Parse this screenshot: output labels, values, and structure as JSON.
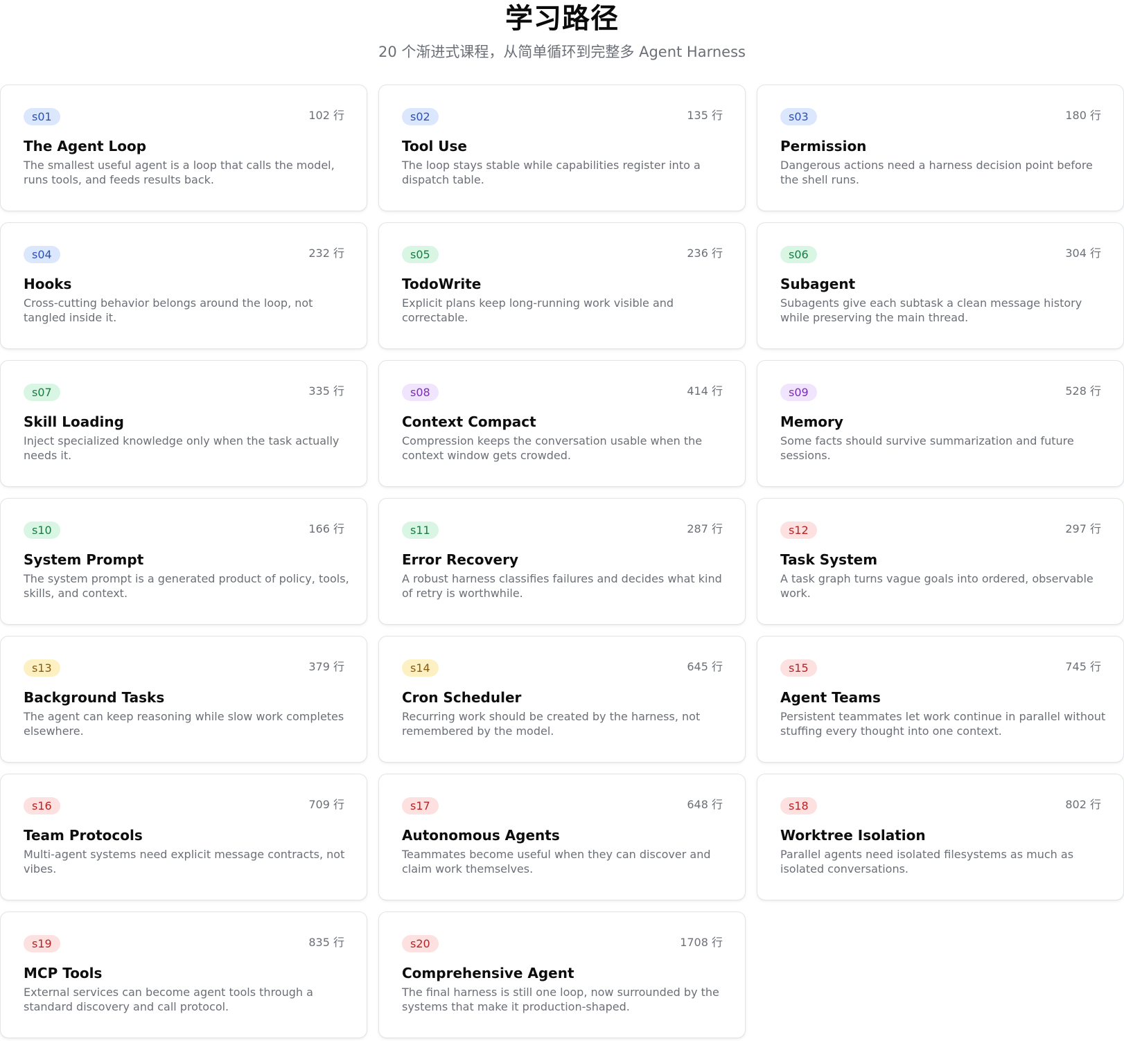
{
  "header": {
    "title": "学习路径",
    "subtitle": "20 个渐进式课程，从简单循环到完整多 Agent Harness"
  },
  "colors": {
    "blue": "#dbe7fd",
    "green": "#d8f6e3",
    "purple": "#f1e4fd",
    "red": "#fde0e0",
    "yellow": "#fdf1c4"
  },
  "lessons": [
    {
      "id": "s01",
      "lines": "102 行",
      "color": "blue",
      "title": "The Agent Loop",
      "desc": "The smallest useful agent is a loop that calls the model, runs tools, and feeds results back."
    },
    {
      "id": "s02",
      "lines": "135 行",
      "color": "blue",
      "title": "Tool Use",
      "desc": "The loop stays stable while capabilities register into a dispatch table."
    },
    {
      "id": "s03",
      "lines": "180 行",
      "color": "blue",
      "title": "Permission",
      "desc": "Dangerous actions need a harness decision point before the shell runs."
    },
    {
      "id": "s04",
      "lines": "232 行",
      "color": "blue",
      "title": "Hooks",
      "desc": "Cross-cutting behavior belongs around the loop, not tangled inside it."
    },
    {
      "id": "s05",
      "lines": "236 行",
      "color": "green",
      "title": "TodoWrite",
      "desc": "Explicit plans keep long-running work visible and correctable."
    },
    {
      "id": "s06",
      "lines": "304 行",
      "color": "green",
      "title": "Subagent",
      "desc": "Subagents give each subtask a clean message history while preserving the main thread."
    },
    {
      "id": "s07",
      "lines": "335 行",
      "color": "green",
      "title": "Skill Loading",
      "desc": "Inject specialized knowledge only when the task actually needs it."
    },
    {
      "id": "s08",
      "lines": "414 行",
      "color": "purple",
      "title": "Context Compact",
      "desc": "Compression keeps the conversation usable when the context window gets crowded."
    },
    {
      "id": "s09",
      "lines": "528 行",
      "color": "purple",
      "title": "Memory",
      "desc": "Some facts should survive summarization and future sessions."
    },
    {
      "id": "s10",
      "lines": "166 行",
      "color": "green",
      "title": "System Prompt",
      "desc": "The system prompt is a generated product of policy, tools, skills, and context."
    },
    {
      "id": "s11",
      "lines": "287 行",
      "color": "green",
      "title": "Error Recovery",
      "desc": "A robust harness classifies failures and decides what kind of retry is worthwhile."
    },
    {
      "id": "s12",
      "lines": "297 行",
      "color": "red",
      "title": "Task System",
      "desc": "A task graph turns vague goals into ordered, observable work."
    },
    {
      "id": "s13",
      "lines": "379 行",
      "color": "yellow",
      "title": "Background Tasks",
      "desc": "The agent can keep reasoning while slow work completes elsewhere."
    },
    {
      "id": "s14",
      "lines": "645 行",
      "color": "yellow",
      "title": "Cron Scheduler",
      "desc": "Recurring work should be created by the harness, not remembered by the model."
    },
    {
      "id": "s15",
      "lines": "745 行",
      "color": "red",
      "title": "Agent Teams",
      "desc": "Persistent teammates let work continue in parallel without stuffing every thought into one context."
    },
    {
      "id": "s16",
      "lines": "709 行",
      "color": "red",
      "title": "Team Protocols",
      "desc": "Multi-agent systems need explicit message contracts, not vibes."
    },
    {
      "id": "s17",
      "lines": "648 行",
      "color": "red",
      "title": "Autonomous Agents",
      "desc": "Teammates become useful when they can discover and claim work themselves."
    },
    {
      "id": "s18",
      "lines": "802 行",
      "color": "red",
      "title": "Worktree Isolation",
      "desc": "Parallel agents need isolated filesystems as much as isolated conversations."
    },
    {
      "id": "s19",
      "lines": "835 行",
      "color": "red",
      "title": "MCP Tools",
      "desc": "External services can become agent tools through a standard discovery and call protocol."
    },
    {
      "id": "s20",
      "lines": "1708 行",
      "color": "red",
      "title": "Comprehensive Agent",
      "desc": "The final harness is still one loop, now surrounded by the systems that make it production-shaped."
    }
  ]
}
